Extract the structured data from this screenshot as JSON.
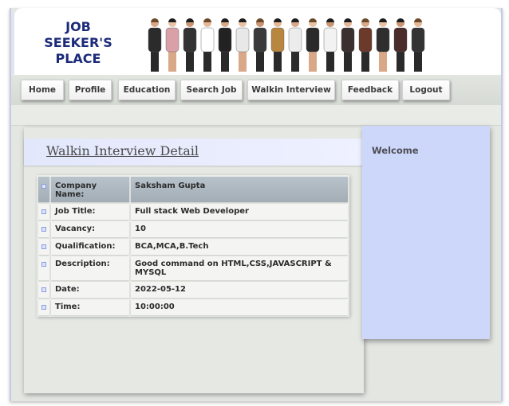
{
  "header": {
    "logo_lines": [
      "JOB",
      "SEEKER'S",
      "PLACE"
    ]
  },
  "nav": {
    "items": [
      {
        "label": "Home"
      },
      {
        "label": "Profile"
      },
      {
        "label": "Education"
      },
      {
        "label": "Search Job"
      },
      {
        "label": "Walkin Interview"
      },
      {
        "label": "Feedback"
      },
      {
        "label": "Logout"
      }
    ]
  },
  "main": {
    "title": "Walkin Interview Detail",
    "rows": [
      {
        "label": "Company Name:",
        "value": "Saksham Gupta"
      },
      {
        "label": "Job Title:",
        "value": "Full stack Web Developer"
      },
      {
        "label": "Vacancy:",
        "value": "10"
      },
      {
        "label": "Qualification:",
        "value": "BCA,MCA,B.Tech"
      },
      {
        "label": "Description:",
        "value": "Good command on HTML,CSS,JAVASCRIPT & MYSQL"
      },
      {
        "label": "Date:",
        "value": "2022-05-12"
      },
      {
        "label": "Time:",
        "value": "10:00:00"
      }
    ]
  },
  "sidebar": {
    "title": "Welcome"
  },
  "colors": {
    "logo_text": "#1c2a7a",
    "sidebar_bg": "#cdd7fa",
    "title_bar_bg": "#e3e7fb",
    "header_row_bg": "#a2adb6"
  }
}
